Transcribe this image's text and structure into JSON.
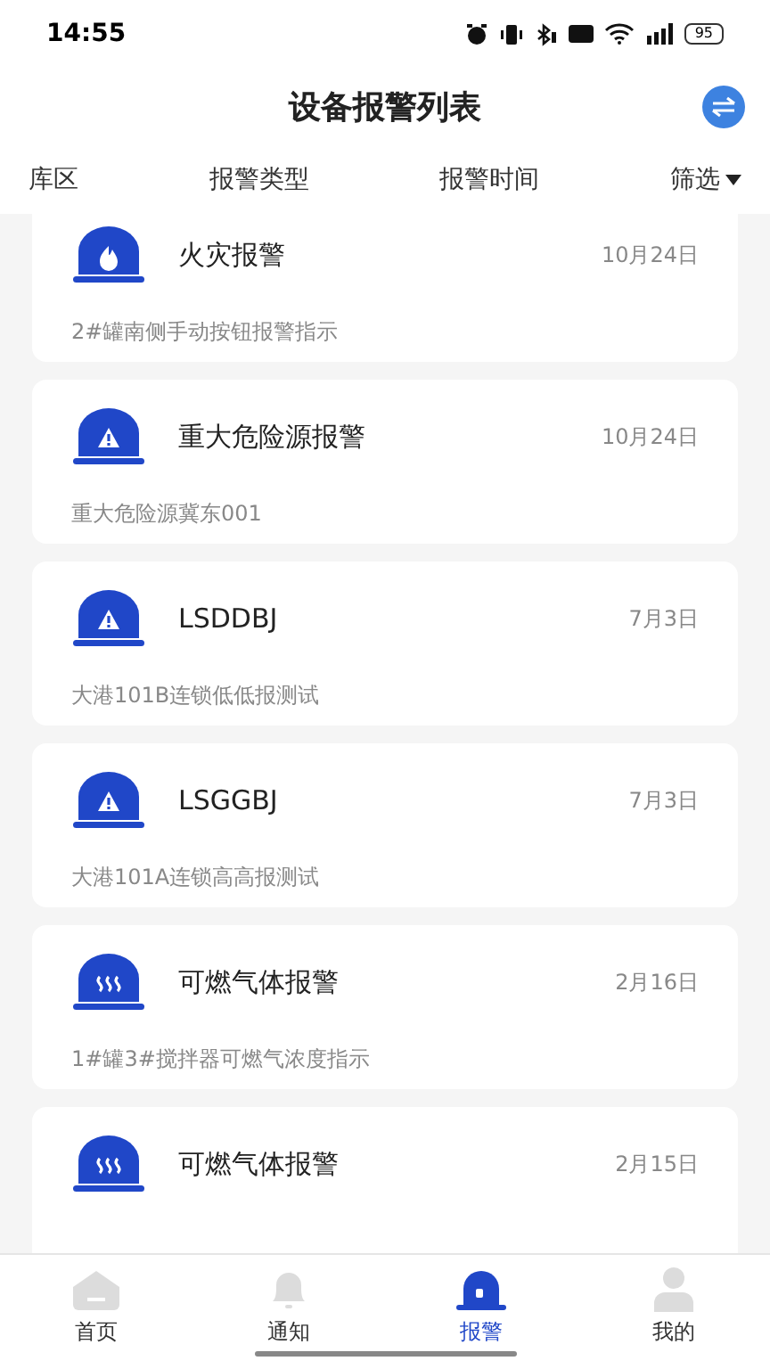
{
  "status_bar": {
    "time": "14:55",
    "battery": "95"
  },
  "header": {
    "title": "设备报警列表"
  },
  "filters": [
    {
      "label": "库区",
      "dropdown": false
    },
    {
      "label": "报警类型",
      "dropdown": false
    },
    {
      "label": "报警时间",
      "dropdown": false
    },
    {
      "label": "筛选",
      "dropdown": true
    }
  ],
  "alarms": [
    {
      "kind": "fire",
      "title": "火灾报警",
      "date": "10月24日",
      "description": "2#罐南侧手动按钮报警指示"
    },
    {
      "kind": "warning",
      "title": "重大危险源报警",
      "date": "10月24日",
      "description": "重大危险源冀东001"
    },
    {
      "kind": "warning",
      "title": "LSDDBJ",
      "date": "7月3日",
      "description": "大港101B连锁低低报测试"
    },
    {
      "kind": "warning",
      "title": "LSGGBJ",
      "date": "7月3日",
      "description": "大港101A连锁高高报测试"
    },
    {
      "kind": "gas",
      "title": "可燃气体报警",
      "date": "2月16日",
      "description": "1#罐3#搅拌器可燃气浓度指示"
    },
    {
      "kind": "gas",
      "title": "可燃气体报警",
      "date": "2月15日"
    }
  ],
  "nav": [
    {
      "kind": "home",
      "label": "首页",
      "selected": false
    },
    {
      "kind": "bell",
      "label": "通知",
      "selected": false
    },
    {
      "kind": "alarm",
      "label": "报警",
      "selected": true
    },
    {
      "kind": "user",
      "label": "我的",
      "selected": false
    }
  ]
}
